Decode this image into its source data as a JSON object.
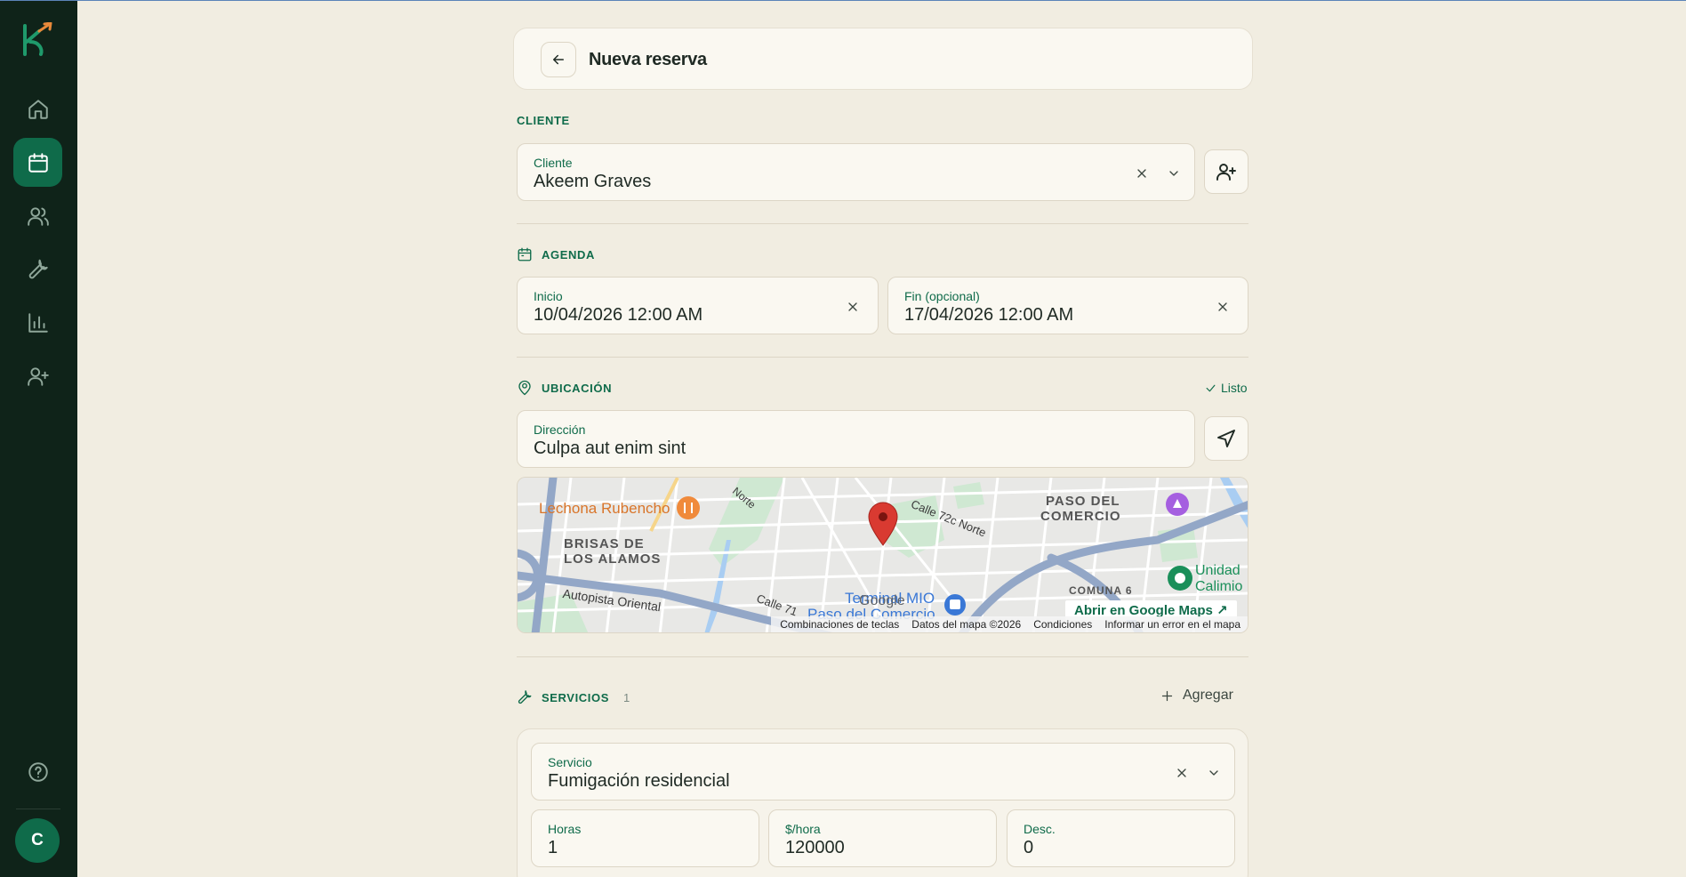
{
  "page": {
    "title": "Nueva reserva"
  },
  "cliente": {
    "section_label": "CLIENTE",
    "field_label": "Cliente",
    "value": "Akeem Graves"
  },
  "agenda": {
    "section_label": "AGENDA",
    "inicio_label": "Inicio",
    "inicio_value": "10/04/2026 12:00 AM",
    "fin_label": "Fin (opcional)",
    "fin_value": "17/04/2026 12:00 AM"
  },
  "ubicacion": {
    "section_label": "UBICACIÓN",
    "status": "Listo",
    "field_label": "Dirección",
    "value": "Culpa aut enim sint"
  },
  "map": {
    "labels": {
      "poi_restaurant": "Lechona Rubencho",
      "area_brisas_1": "BRISAS DE",
      "area_brisas_2": "LOS ALAMOS",
      "road_autopista": "Autopista Oriental",
      "road_norte": "Norte",
      "road_calle72c": "Calle 72c Norte",
      "area_paso_1": "PASO DEL",
      "area_paso_2": "COMERCIO",
      "poi_unidad_1": "Unidad",
      "poi_unidad_2": "Calimio",
      "area_comuna": "COMUNA 6",
      "road_calle71": "Calle 71",
      "poi_terminal_1": "Terminal MIO",
      "poi_terminal_2": "Paso del Comercio",
      "google": "Google"
    },
    "open_link": "Abrir en Google Maps ↗",
    "footer": [
      "Combinaciones de teclas",
      "Datos del mapa ©2026",
      "Condiciones",
      "Informar un error en el mapa"
    ]
  },
  "servicios": {
    "section_label": "SERVICIOS",
    "count": "1",
    "add_label": "Agregar",
    "items": [
      {
        "servicio_label": "Servicio",
        "servicio_value": "Fumigación residencial",
        "horas_label": "Horas",
        "horas_value": "1",
        "precio_label": "$/hora",
        "precio_value": "120000",
        "desc_label": "Desc.",
        "desc_value": "0"
      }
    ]
  },
  "user": {
    "initial": "C"
  },
  "colors": {
    "sidebar_bg": "#0f2319",
    "accent": "#0f6b4a",
    "page_bg": "#f1ede1",
    "card_bg": "#faf8f1"
  }
}
